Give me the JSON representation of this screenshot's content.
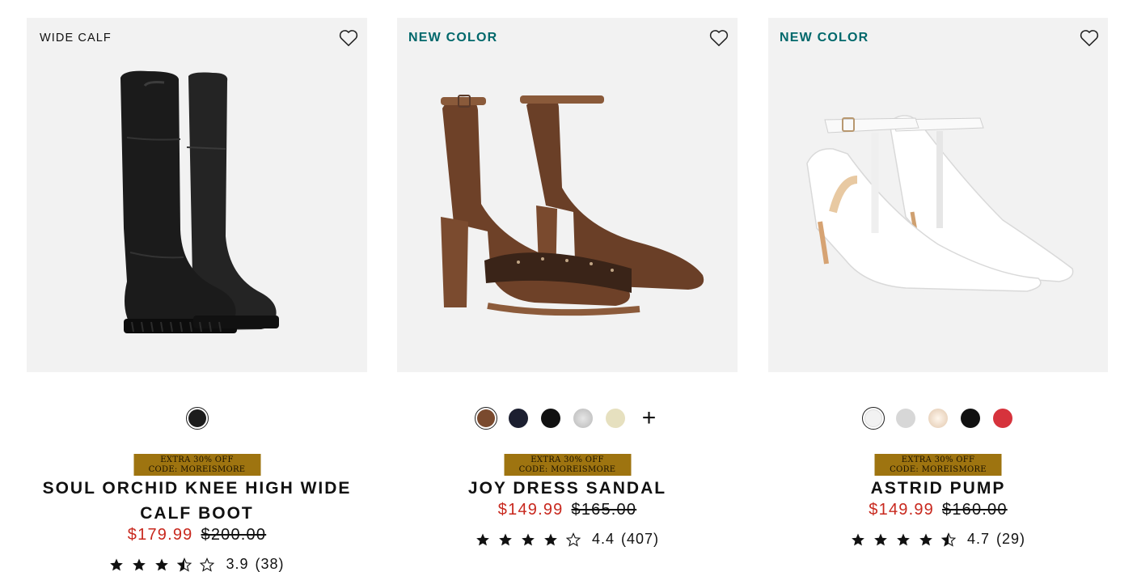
{
  "products": [
    {
      "badge": "WIDE CALF",
      "name": "SOUL ORCHID KNEE HIGH WIDE CALF BOOT",
      "promo_line1": "EXTRA 30% OFF",
      "promo_line2": "CODE: MOREISMORE",
      "price_sale": "$179.99",
      "price_original": "$200.00",
      "rating": "3.9",
      "review_count": "(38)",
      "star_value": 3.5,
      "swatches": [
        "#1c1c1c"
      ]
    },
    {
      "badge": "NEW COLOR",
      "name": "JOY DRESS SANDAL",
      "promo_line1": "EXTRA 30% OFF",
      "promo_line2": "CODE: MOREISMORE",
      "price_sale": "$149.99",
      "price_original": "$165.00",
      "rating": "4.4",
      "review_count": "(407)",
      "star_value": 4,
      "swatches": [
        "#7a4a2e",
        "#1c1f30",
        "#111111",
        "#c9c9c9",
        "#e6e0bf"
      ],
      "more_label": "+"
    },
    {
      "badge": "NEW COLOR",
      "name": "ASTRID PUMP",
      "promo_line1": "EXTRA 30% OFF",
      "promo_line2": "CODE: MOREISMORE",
      "price_sale": "$149.99",
      "price_original": "$160.00",
      "rating": "4.7",
      "review_count": "(29)",
      "star_value": 4.5,
      "swatches": [
        "#f2f2f2",
        "#d7d7d7",
        "#efe0cf",
        "#111111",
        "#d6333c"
      ]
    }
  ],
  "colors": {
    "teal_badge": "#00686b",
    "sale_red": "#c8281e",
    "promo_gold": "#9e7410",
    "image_bg": "#f2f2f2"
  }
}
